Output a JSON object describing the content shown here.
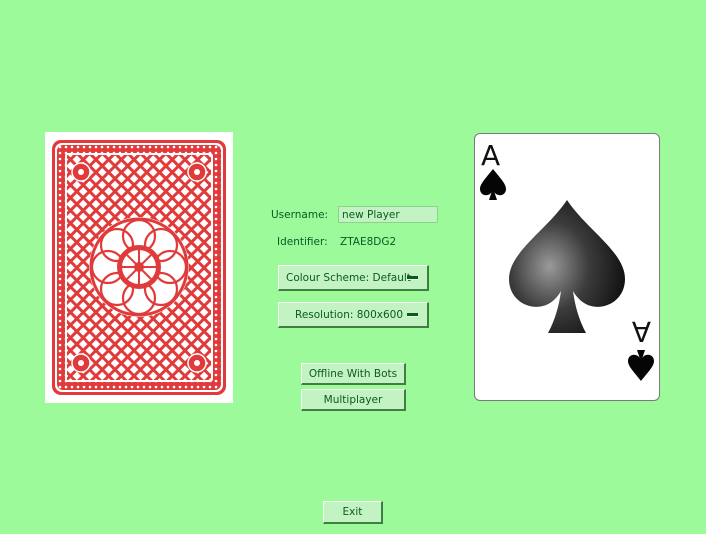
{
  "form": {
    "username_label": "Username:",
    "username_value": "new Player",
    "identifier_label": "Identifier:",
    "identifier_value": "ZTAE8DG2"
  },
  "menus": {
    "colour_scheme": "Colour Scheme: Default",
    "resolution": "Resolution: 800x600"
  },
  "buttons": {
    "offline": "Offline With Bots",
    "multiplayer": "Multiplayer",
    "exit": "Exit"
  },
  "cards": {
    "back_icon": "card-back-pattern",
    "back_color": "#e03a3a",
    "face_rank": "A",
    "face_suit": "spade"
  },
  "colors": {
    "background": "#9dfa9b",
    "button_face": "#c3f3c2",
    "text": "#0b5a21"
  }
}
